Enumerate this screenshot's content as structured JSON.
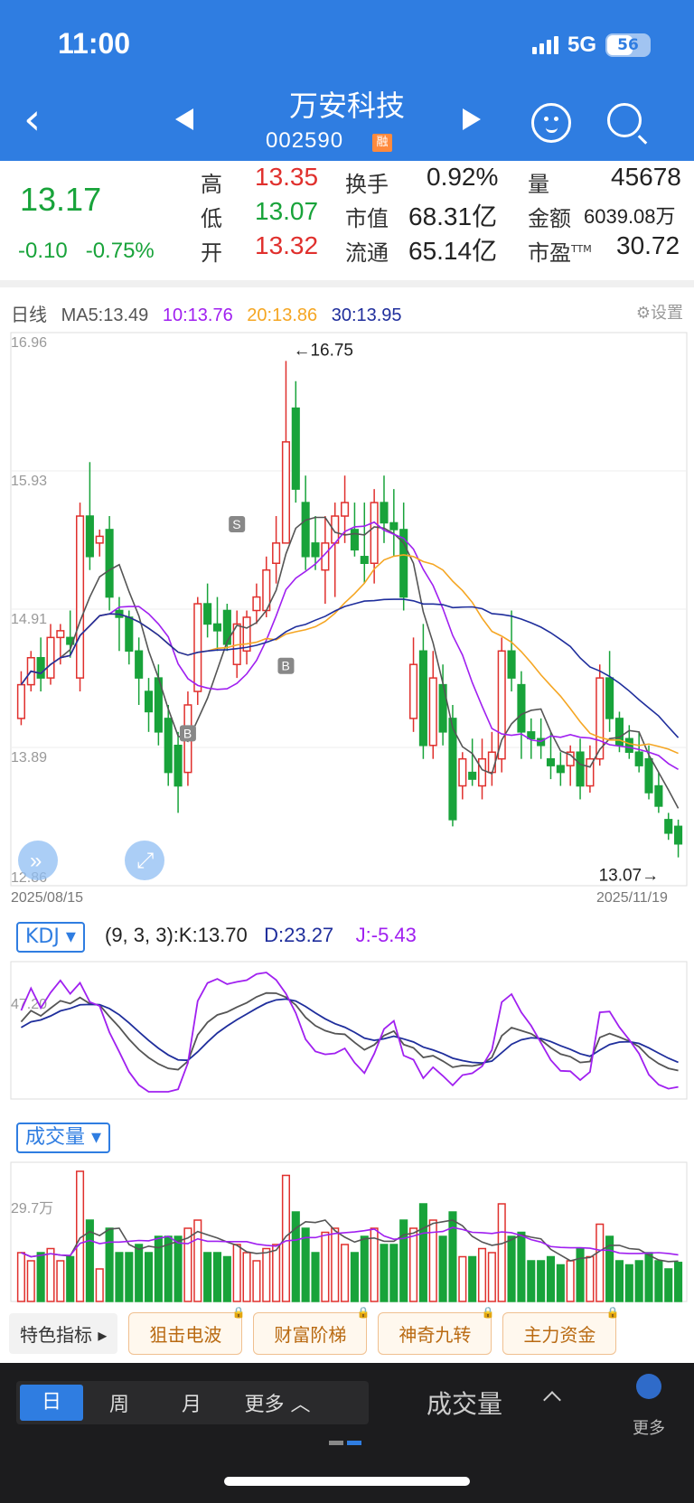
{
  "status": {
    "time": "11:00",
    "network": "5G",
    "battery": "56"
  },
  "header": {
    "name": "万安科技",
    "code": "002590",
    "badge": "融"
  },
  "quote": {
    "price": "13.17",
    "change": "-0.10",
    "change_pct": "-0.75%",
    "high_label": "高",
    "high": "13.35",
    "low_label": "低",
    "low": "13.07",
    "open_label": "开",
    "open": "13.32",
    "turnover_label": "换手",
    "turnover": "0.92%",
    "mktcap_label": "市值",
    "mktcap": "68.31亿",
    "float_label": "流通",
    "float": "65.14亿",
    "volume_label": "量",
    "volume": "45678",
    "amount_label": "金额",
    "amount": "6039.08万",
    "pe_label": "市盈",
    "pe_sup": "TTM",
    "pe": "30.72"
  },
  "legend": {
    "period": "日线",
    "ma5": "MA5:13.49",
    "ma10": "10:13.76",
    "ma20": "20:13.86",
    "ma30": "30:13.95",
    "settings": "设置"
  },
  "colors": {
    "up": "#e0302d",
    "down": "#18a33a",
    "ma5": "#555555",
    "ma10": "#a020f0",
    "ma20": "#f5a623",
    "ma30": "#1f2e9c",
    "accent": "#2f7de1"
  },
  "chart_data": [
    {
      "type": "candlestick",
      "y_ticks": [
        "16.96",
        "15.93",
        "14.91",
        "13.89",
        "12.86"
      ],
      "ylim": [
        12.86,
        16.96
      ],
      "x_start": "2025/08/15",
      "x_end": "2025/11/19",
      "max_label": "←16.75",
      "min_label": "13.07→",
      "ohlc": [
        [
          14.1,
          14.45,
          14.05,
          14.35
        ],
        [
          14.35,
          14.6,
          14.3,
          14.55
        ],
        [
          14.55,
          14.7,
          14.3,
          14.4
        ],
        [
          14.4,
          14.8,
          14.35,
          14.7
        ],
        [
          14.7,
          14.8,
          14.5,
          14.75
        ],
        [
          14.7,
          14.9,
          14.55,
          14.65
        ],
        [
          14.4,
          15.7,
          14.3,
          15.6
        ],
        [
          15.6,
          16.0,
          15.2,
          15.3
        ],
        [
          15.4,
          15.5,
          15.3,
          15.45
        ],
        [
          15.5,
          15.6,
          14.9,
          15.0
        ],
        [
          14.9,
          15.0,
          14.6,
          14.85
        ],
        [
          14.85,
          14.9,
          14.5,
          14.6
        ],
        [
          14.6,
          14.7,
          14.2,
          14.4
        ],
        [
          14.3,
          14.4,
          14.0,
          14.15
        ],
        [
          14.4,
          14.5,
          13.9,
          14.0
        ],
        [
          14.1,
          14.2,
          13.6,
          13.7
        ],
        [
          13.9,
          14.0,
          13.4,
          13.6
        ],
        [
          13.7,
          14.3,
          13.6,
          14.2
        ],
        [
          14.3,
          15.0,
          14.2,
          14.95
        ],
        [
          14.95,
          15.1,
          14.7,
          14.8
        ],
        [
          14.8,
          15.0,
          14.6,
          14.75
        ],
        [
          14.9,
          14.95,
          14.6,
          14.65
        ],
        [
          14.5,
          14.9,
          14.4,
          14.8
        ],
        [
          14.6,
          14.9,
          14.5,
          14.85
        ],
        [
          14.9,
          15.1,
          14.8,
          15.0
        ],
        [
          14.9,
          15.3,
          14.85,
          15.2
        ],
        [
          15.25,
          15.6,
          15.1,
          15.4
        ],
        [
          15.4,
          16.75,
          15.4,
          16.15
        ],
        [
          16.4,
          16.6,
          15.7,
          15.8
        ],
        [
          15.7,
          15.9,
          15.2,
          15.3
        ],
        [
          15.4,
          15.6,
          15.2,
          15.3
        ],
        [
          15.2,
          15.6,
          14.95,
          15.4
        ],
        [
          15.4,
          15.7,
          15.0,
          15.6
        ],
        [
          15.6,
          15.9,
          15.4,
          15.7
        ],
        [
          15.5,
          15.7,
          15.3,
          15.35
        ],
        [
          15.3,
          15.7,
          15.1,
          15.25
        ],
        [
          15.25,
          15.8,
          15.1,
          15.7
        ],
        [
          15.7,
          15.9,
          15.4,
          15.55
        ],
        [
          15.55,
          15.8,
          15.3,
          15.5
        ],
        [
          15.5,
          15.7,
          14.9,
          15.0
        ],
        [
          14.1,
          14.7,
          14.0,
          14.5
        ],
        [
          14.6,
          14.8,
          13.8,
          13.9
        ],
        [
          13.9,
          14.6,
          13.8,
          14.4
        ],
        [
          14.35,
          14.5,
          13.9,
          14.0
        ],
        [
          14.1,
          14.2,
          13.3,
          13.35
        ],
        [
          13.6,
          13.85,
          13.5,
          13.8
        ],
        [
          13.7,
          13.95,
          13.6,
          13.65
        ],
        [
          13.6,
          13.95,
          13.5,
          13.8
        ],
        [
          13.7,
          14.0,
          13.6,
          13.85
        ],
        [
          13.8,
          14.7,
          13.7,
          14.6
        ],
        [
          14.6,
          14.9,
          14.3,
          14.4
        ],
        [
          14.35,
          14.45,
          13.8,
          14.0
        ],
        [
          14.0,
          14.1,
          13.8,
          13.95
        ],
        [
          13.95,
          14.1,
          13.8,
          13.9
        ],
        [
          13.8,
          14.0,
          13.65,
          13.75
        ],
        [
          13.75,
          13.85,
          13.6,
          13.7
        ],
        [
          13.75,
          13.9,
          13.6,
          13.85
        ],
        [
          13.85,
          13.95,
          13.5,
          13.6
        ],
        [
          13.6,
          13.9,
          13.55,
          13.8
        ],
        [
          13.8,
          14.5,
          13.75,
          14.4
        ],
        [
          14.4,
          14.6,
          14.0,
          14.1
        ],
        [
          14.1,
          14.15,
          13.85,
          13.9
        ],
        [
          13.95,
          14.05,
          13.8,
          13.85
        ],
        [
          13.85,
          14.0,
          13.7,
          13.75
        ],
        [
          13.8,
          13.9,
          13.5,
          13.55
        ],
        [
          13.6,
          13.7,
          13.4,
          13.45
        ],
        [
          13.35,
          13.4,
          13.2,
          13.25
        ],
        [
          13.3,
          13.35,
          13.07,
          13.17
        ]
      ]
    },
    {
      "type": "line",
      "name": "KDJ",
      "params": "(9, 3, 3):",
      "tick": "47.20",
      "k_label": "K:13.70",
      "d_label": "D:23.27",
      "j_label": "J:-5.43"
    },
    {
      "type": "bar",
      "name": "成交量",
      "tick": "29.7万"
    }
  ],
  "kdj_btn": "KDJ",
  "vol_btn": "成交量",
  "tools": {
    "main": "特色指标",
    "t1": "狙击电波",
    "t2": "财富阶梯",
    "t3": "神奇九转",
    "t4": "主力资金"
  },
  "bottom": {
    "day": "日",
    "week": "周",
    "month": "月",
    "more": "更多",
    "indicator": "成交量",
    "more2": "更多"
  },
  "markers": {
    "s": "S",
    "b": "B"
  }
}
